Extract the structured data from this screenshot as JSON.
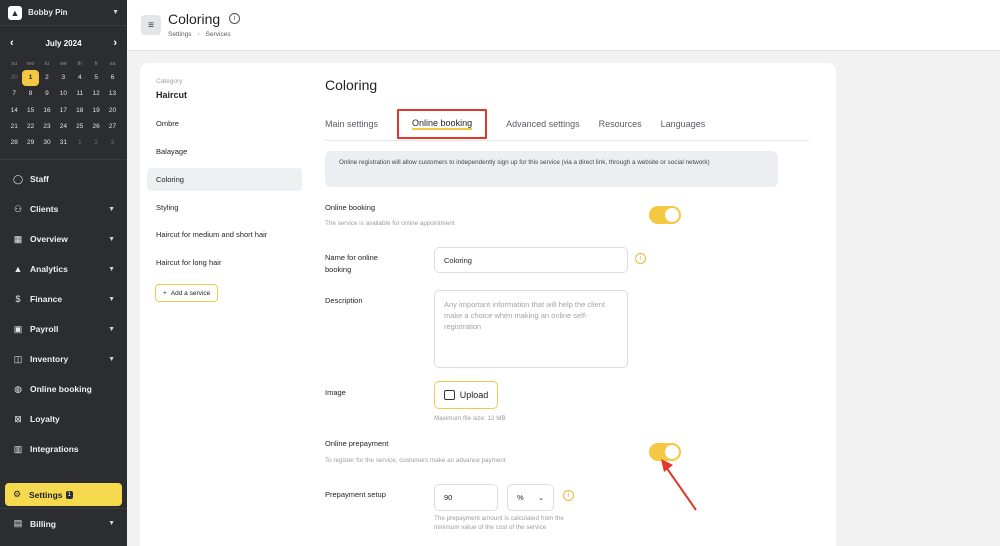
{
  "sidebar": {
    "user": "Bobby Pin",
    "calendar": {
      "month": "July 2024",
      "dow": [
        "su",
        "mo",
        "tu",
        "we",
        "th",
        "fr",
        "sa"
      ],
      "days": [
        "30",
        "1",
        "2",
        "3",
        "4",
        "5",
        "6",
        "7",
        "8",
        "9",
        "10",
        "11",
        "12",
        "13",
        "14",
        "15",
        "16",
        "17",
        "18",
        "19",
        "20",
        "21",
        "22",
        "23",
        "24",
        "25",
        "26",
        "27",
        "28",
        "29",
        "30",
        "31",
        "1",
        "2",
        "3"
      ],
      "today": "1"
    },
    "nav": [
      {
        "label": "Staff",
        "icon": "person-icon"
      },
      {
        "label": "Clients",
        "icon": "clients-icon"
      },
      {
        "label": "Overview",
        "icon": "grid-icon"
      },
      {
        "label": "Analytics",
        "icon": "chart-icon"
      },
      {
        "label": "Finance",
        "icon": "dollar-icon"
      },
      {
        "label": "Payroll",
        "icon": "payroll-icon"
      },
      {
        "label": "Inventory",
        "icon": "box-icon"
      },
      {
        "label": "Online booking",
        "icon": "globe-icon"
      },
      {
        "label": "Loyalty",
        "icon": "loyalty-icon"
      },
      {
        "label": "Integrations",
        "icon": "store-icon"
      }
    ],
    "settings_label": "Settings",
    "settings_badge": "1",
    "billing_label": "Billing"
  },
  "header": {
    "title": "Coloring",
    "breadcrumb": [
      "Settings",
      "Services"
    ]
  },
  "services": {
    "category_label": "Category",
    "category_name": "Haircut",
    "items": [
      "Ombre",
      "Balayage",
      "Coloring",
      "Styling",
      "Haircut for medium and short hair",
      "Haircut for long hair"
    ],
    "active": "Coloring",
    "add_label": "Add a service"
  },
  "detail": {
    "title": "Coloring",
    "tabs": [
      "Main settings",
      "Online booking",
      "Advanced settings",
      "Resources",
      "Languages"
    ],
    "active_tab": "Online booking",
    "notice": "Online registration will allow customers to independently sign up for this service (via a direct link, through a website or social network)",
    "online_booking": {
      "label": "Online booking",
      "sub": "The service is available for online appointment",
      "enabled": true
    },
    "name_field": {
      "label": "Name for online booking",
      "value": "Coloring"
    },
    "description": {
      "label": "Description",
      "placeholder": "Any important information that will help the client make a choice when making an online self-registration"
    },
    "image": {
      "label": "Image",
      "button": "Upload",
      "hint": "Maximum file size: 12 MB"
    },
    "prepayment": {
      "label": "Online prepayment",
      "sub": "To register for the service, customers make an advance payment",
      "enabled": true
    },
    "prepayment_setup": {
      "label": "Prepayment setup",
      "value": "90",
      "unit": "%",
      "hint": "The prepayment amount is calculated from the minimum value of the cost of the service"
    }
  },
  "colors": {
    "accent": "#f5c842",
    "highlight": "#e0362c",
    "sidebar": "#2c2d31"
  }
}
